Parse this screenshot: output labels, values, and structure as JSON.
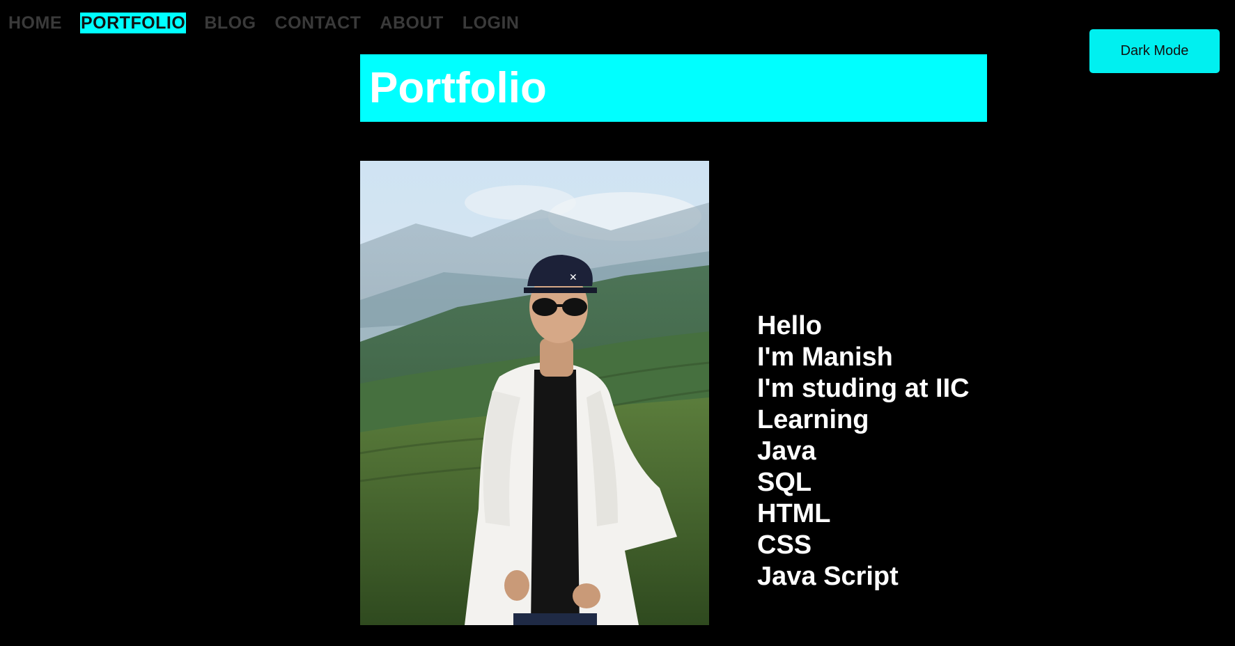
{
  "nav": {
    "items": [
      {
        "label": "HOME",
        "active": false
      },
      {
        "label": "PORTFOLIO",
        "active": true
      },
      {
        "label": "BLOG",
        "active": false
      },
      {
        "label": "CONTACT",
        "active": false
      },
      {
        "label": "ABOUT",
        "active": false
      },
      {
        "label": "LOGIN",
        "active": false
      }
    ]
  },
  "toolbar": {
    "dark_mode_label": "Dark Mode"
  },
  "page": {
    "title": "Portfolio"
  },
  "bio": {
    "lines": [
      "Hello",
      "I'm Manish",
      "I'm studing at IIC",
      "Learning",
      "Java",
      "SQL",
      "HTML",
      "CSS",
      "Java Script"
    ]
  },
  "colors": {
    "accent": "#00ffff",
    "background": "#000000",
    "nav_text": "#3a3a3a",
    "text": "#ffffff"
  }
}
